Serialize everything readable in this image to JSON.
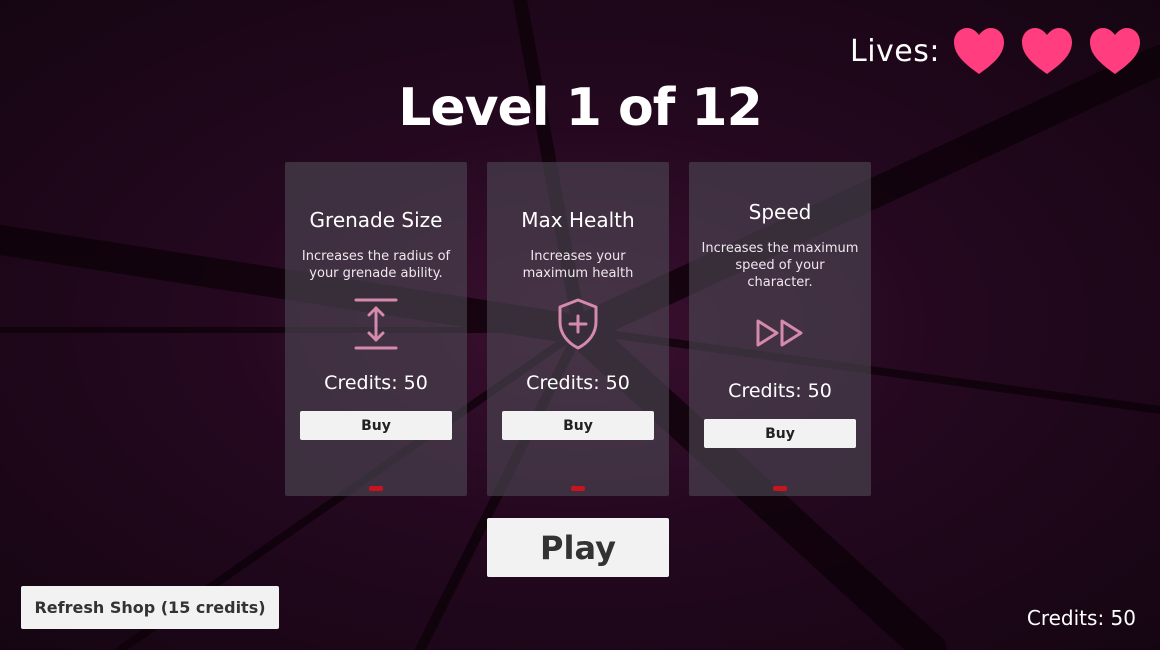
{
  "hud": {
    "lives_label": "Lives:",
    "lives_count": 3,
    "heart_color": "#ff3d7f",
    "credits_label": "Credits: 50"
  },
  "level": {
    "title": "Level 1 of 12"
  },
  "shop": {
    "cards": [
      {
        "title": "Grenade Size",
        "description": "Increases the radius of your grenade ability.",
        "icon": "resize-vertical-icon",
        "cost": "Credits: 50",
        "buy_label": "Buy"
      },
      {
        "title": "Max Health",
        "description": "Increases your maximum health",
        "icon": "shield-plus-icon",
        "cost": "Credits: 50",
        "buy_label": "Buy"
      },
      {
        "title": "Speed",
        "description": "Increases the maximum speed of your character.",
        "icon": "fast-forward-icon",
        "cost": "Credits: 50",
        "buy_label": "Buy"
      }
    ],
    "icon_color": "#d48aac",
    "indicator_color": "#c8141e"
  },
  "actions": {
    "play_label": "Play",
    "refresh_label": "Refresh Shop (15 credits)"
  }
}
